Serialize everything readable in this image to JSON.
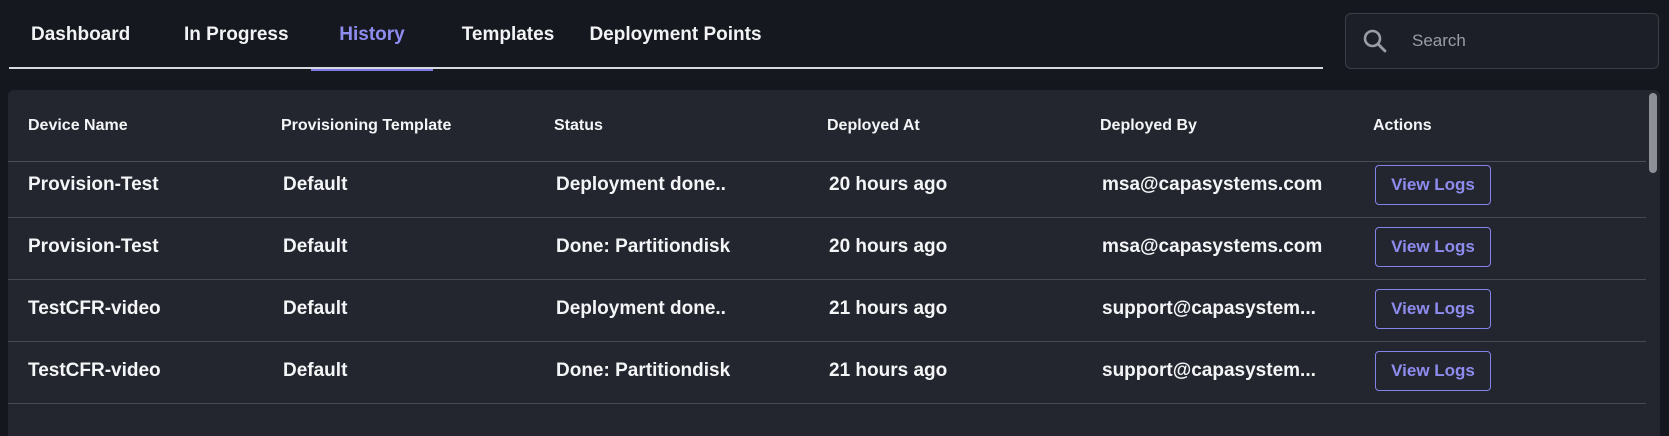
{
  "tabs": [
    {
      "label": "Dashboard",
      "active": false
    },
    {
      "label": "In Progress",
      "active": false
    },
    {
      "label": "History",
      "active": true
    },
    {
      "label": "Templates",
      "active": false
    },
    {
      "label": "Deployment Points",
      "active": false
    }
  ],
  "search": {
    "placeholder": "Search",
    "icon": "search-icon"
  },
  "table": {
    "columns": [
      "Device Name",
      "Provisioning Template",
      "Status",
      "Deployed At",
      "Deployed By",
      "Actions"
    ],
    "rows": [
      {
        "device": "Provision-Test",
        "template": "Default",
        "status": "Deployment done..",
        "deployed_at": "20 hours ago",
        "deployed_by": "msa@capasystems.com",
        "action": "View Logs"
      },
      {
        "device": "Provision-Test",
        "template": "Default",
        "status": "Done: Partitiondisk",
        "deployed_at": "20 hours ago",
        "deployed_by": "msa@capasystems.com",
        "action": "View Logs"
      },
      {
        "device": "TestCFR-video",
        "template": "Default",
        "status": "Deployment done..",
        "deployed_at": "21 hours ago",
        "deployed_by": "support@capasystem...",
        "action": "View Logs"
      },
      {
        "device": "TestCFR-video",
        "template": "Default",
        "status": "Done: Partitiondisk",
        "deployed_at": "21 hours ago",
        "deployed_by": "support@capasystem...",
        "action": "View Logs"
      }
    ]
  },
  "colors": {
    "background": "#14171e",
    "table": "#23262f",
    "accent": "#8f8cf0",
    "text": "#f4f5f7"
  }
}
